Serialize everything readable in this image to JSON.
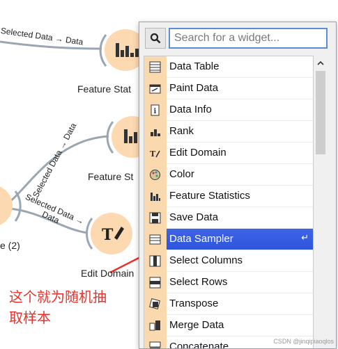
{
  "canvas": {
    "link_labels": [
      "Selected Data → Data",
      "Selected Data → Data",
      "Selected Data →",
      "Data"
    ],
    "node_labels": [
      "Feature Stat",
      "Feature St",
      "e (2)",
      "Edit Domain"
    ]
  },
  "search": {
    "placeholder": "Search for a widget..."
  },
  "widgets": [
    {
      "label": "Data Table",
      "icon": "data-table-icon"
    },
    {
      "label": "Paint Data",
      "icon": "paint-data-icon"
    },
    {
      "label": "Data Info",
      "icon": "data-info-icon"
    },
    {
      "label": "Rank",
      "icon": "rank-icon"
    },
    {
      "label": "Edit Domain",
      "icon": "edit-domain-icon"
    },
    {
      "label": "Color",
      "icon": "color-icon"
    },
    {
      "label": "Feature Statistics",
      "icon": "feature-statistics-icon"
    },
    {
      "label": "Save Data",
      "icon": "save-data-icon"
    },
    {
      "label": "Data Sampler",
      "icon": "data-sampler-icon",
      "selected": true,
      "enter_glyph": "↵"
    },
    {
      "label": "Select Columns",
      "icon": "select-columns-icon"
    },
    {
      "label": "Select Rows",
      "icon": "select-rows-icon"
    },
    {
      "label": "Transpose",
      "icon": "transpose-icon"
    },
    {
      "label": "Merge Data",
      "icon": "merge-data-icon"
    },
    {
      "label": "Concatenate",
      "icon": "concatenate-icon"
    }
  ],
  "annotation": {
    "line1": "这个就为随机抽",
    "line2": "取样本"
  },
  "watermark": "CSDN @jinqipiaoqlos",
  "colors": {
    "node_fill": "#fcd9b0",
    "link": "#9aa6b2",
    "selected": "#3559df",
    "annotation": "#e8322b",
    "search_border": "#5a8dd8"
  }
}
